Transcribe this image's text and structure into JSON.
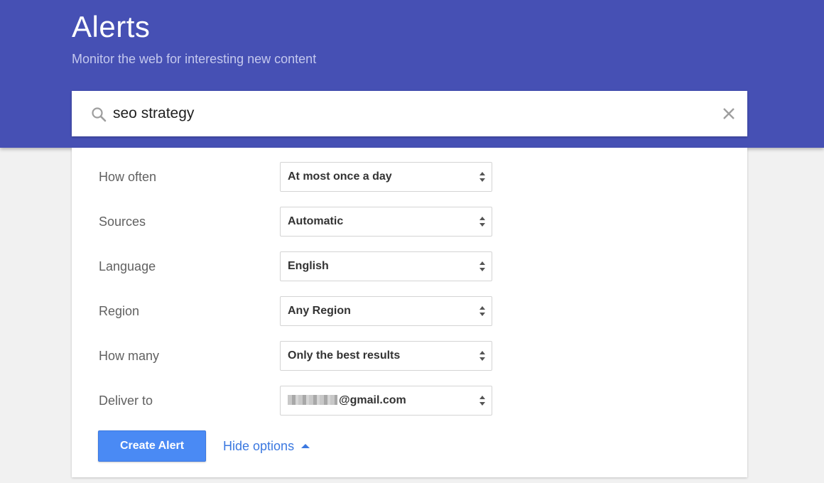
{
  "header": {
    "title": "Alerts",
    "subtitle": "Monitor the web for interesting new content",
    "background_color": "#4650b4"
  },
  "search": {
    "value": "seo strategy",
    "search_icon": "search-icon",
    "clear_icon": "close-icon"
  },
  "options": {
    "rows": [
      {
        "label": "How often",
        "value": "At most once a day"
      },
      {
        "label": "Sources",
        "value": "Automatic"
      },
      {
        "label": "Language",
        "value": "English"
      },
      {
        "label": "Region",
        "value": "Any Region"
      },
      {
        "label": "How many",
        "value": "Only the best results"
      },
      {
        "label": "Deliver to",
        "value": "@gmail.com"
      }
    ]
  },
  "actions": {
    "create_label": "Create Alert",
    "create_color": "#4a8af4",
    "hide_options_label": "Hide options",
    "hide_options_icon": "triangle-up-icon",
    "link_color": "#3b78e0"
  }
}
